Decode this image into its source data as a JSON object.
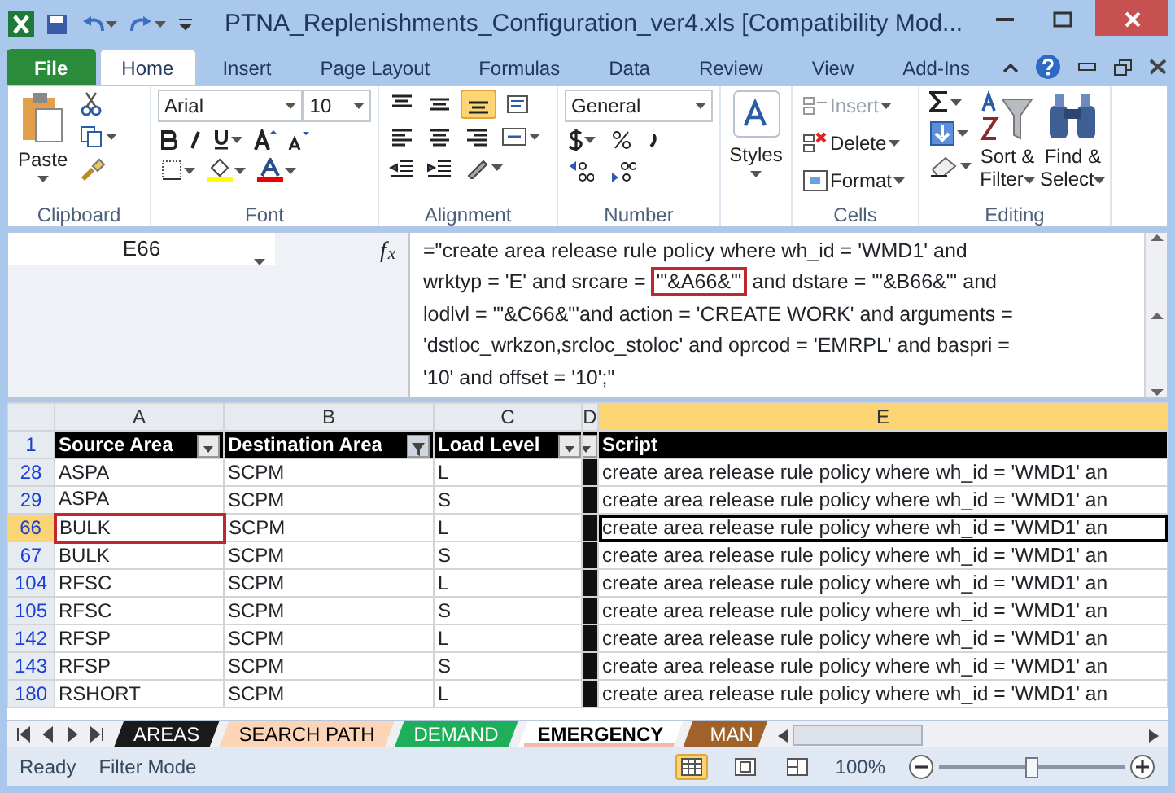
{
  "window": {
    "title": "PTNA_Replenishments_Configuration_ver4.xls  [Compatibility Mod..."
  },
  "tabs": [
    {
      "label": "File",
      "kind": "file",
      "selected": false
    },
    {
      "label": "Home",
      "kind": "tab",
      "selected": true
    },
    {
      "label": "Insert",
      "kind": "tab",
      "selected": false
    },
    {
      "label": "Page Layout",
      "kind": "tab",
      "selected": false
    },
    {
      "label": "Formulas",
      "kind": "tab",
      "selected": false
    },
    {
      "label": "Data",
      "kind": "tab",
      "selected": false
    },
    {
      "label": "Review",
      "kind": "tab",
      "selected": false
    },
    {
      "label": "View",
      "kind": "tab",
      "selected": false
    },
    {
      "label": "Add-Ins",
      "kind": "tab",
      "selected": false
    }
  ],
  "ribbon": {
    "clipboard": {
      "label": "Clipboard",
      "paste": "Paste"
    },
    "font": {
      "label": "Font",
      "name": "Arial",
      "size": "10"
    },
    "alignment": {
      "label": "Alignment",
      "buttons": [
        {
          "kind": "top",
          "selected": false
        },
        {
          "kind": "middle",
          "selected": false
        },
        {
          "kind": "bottom",
          "selected": true
        }
      ]
    },
    "number": {
      "label": "Number",
      "format": "General"
    },
    "styles": {
      "label": "Styles"
    },
    "cells": {
      "label": "Cells",
      "buttons": [
        {
          "label": "Insert",
          "kind": "insert",
          "disabled": true
        },
        {
          "label": "Delete",
          "kind": "delete",
          "disabled": false
        },
        {
          "label": "Format",
          "kind": "format",
          "disabled": false
        }
      ]
    },
    "editing": {
      "label": "Editing",
      "sort": [
        "Sort &",
        "Filter"
      ],
      "find": [
        "Find &",
        "Select"
      ]
    }
  },
  "formula_bar": {
    "name_box": "E66",
    "function_label": "f$_{x}$",
    "before": "=\"create area release rule policy where wh_id = 'WMD1' and wrktyp = 'E' and srcare = ",
    "highlight": "'\"&A66&\"'",
    "after": " and dstare = '\"&B66&\"' and lodlvl = '\"&C66&\"'and action = 'CREATE WORK' and arguments = 'dstloc_wrkzon,srcloc_stoloc' and oprcod = 'EMRPL' and baspri = '10' and offset = '10';\""
  },
  "grid": {
    "columns": [
      {
        "label": "A",
        "selected": false
      },
      {
        "label": "B",
        "selected": false
      },
      {
        "label": "C",
        "selected": false
      },
      {
        "label": "D",
        "selected": false
      },
      {
        "label": "E",
        "selected": true
      }
    ],
    "header_row": {
      "number": "1",
      "cells": [
        {
          "text": "Source Area",
          "dropdown": true
        },
        {
          "text": "Destination Area",
          "dropdown": true,
          "filtered": true
        },
        {
          "text": "Load Level",
          "dropdown": true
        },
        {
          "text": "",
          "dropdown": true
        },
        {
          "text": "Script"
        }
      ]
    },
    "rows": [
      {
        "number": "28",
        "source": "ASPA",
        "destination": "SCPM",
        "level": "L",
        "script": "create area release rule policy where wh_id = 'WMD1' an",
        "selected": false,
        "annotated": false
      },
      {
        "number": "29",
        "source": "ASPA",
        "destination": "SCPM",
        "level": "S",
        "script": "create area release rule policy where wh_id = 'WMD1' an",
        "selected": false,
        "annotated": false
      },
      {
        "number": "66",
        "source": "BULK",
        "destination": "SCPM",
        "level": "L",
        "script": "create area release rule policy where wh_id = 'WMD1' an",
        "selected": true,
        "annotated": true
      },
      {
        "number": "67",
        "source": "BULK",
        "destination": "SCPM",
        "level": "S",
        "script": "create area release rule policy where wh_id = 'WMD1' an",
        "selected": false,
        "annotated": false
      },
      {
        "number": "104",
        "source": "RFSC",
        "destination": "SCPM",
        "level": "L",
        "script": "create area release rule policy where wh_id = 'WMD1' an",
        "selected": false,
        "annotated": false
      },
      {
        "number": "105",
        "source": "RFSC",
        "destination": "SCPM",
        "level": "S",
        "script": "create area release rule policy where wh_id = 'WMD1' an",
        "selected": false,
        "annotated": false
      },
      {
        "number": "142",
        "source": "RFSP",
        "destination": "SCPM",
        "level": "L",
        "script": "create area release rule policy where wh_id = 'WMD1' an",
        "selected": false,
        "annotated": false
      },
      {
        "number": "143",
        "source": "RFSP",
        "destination": "SCPM",
        "level": "S",
        "script": "create area release rule policy where wh_id = 'WMD1' an",
        "selected": false,
        "annotated": false
      },
      {
        "number": "180",
        "source": "RSHORT",
        "destination": "SCPM",
        "level": "L",
        "script": "create area release rule policy where wh_id = 'WMD1' an",
        "selected": false,
        "annotated": false
      }
    ]
  },
  "sheet_tabs": [
    {
      "label": "AREAS",
      "color": "#1a1a1a",
      "selected": false
    },
    {
      "label": "SEARCH PATH",
      "color": "#fbd5b5",
      "selected": false
    },
    {
      "label": "DEMAND",
      "color": "#1fae5a",
      "selected": false
    },
    {
      "label": "EMERGENCY",
      "color": "#f2b8b0",
      "selected": true
    },
    {
      "label": "MAN",
      "color": "#a0622a",
      "selected": false
    }
  ],
  "status_bar": {
    "items": [
      "Ready",
      "Filter Mode"
    ],
    "zoom": "100%",
    "zoom_level": {
      "level": 0.5
    }
  }
}
